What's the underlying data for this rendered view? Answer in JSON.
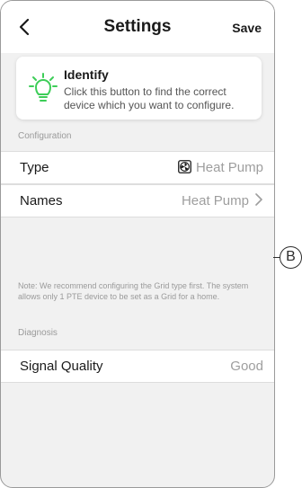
{
  "header": {
    "title": "Settings",
    "save_label": "Save"
  },
  "identify": {
    "title": "Identify",
    "description": "Click this button to find the correct device which you want to configure.",
    "icon": "lightbulb-icon",
    "accent_color": "#3dcd58"
  },
  "configuration": {
    "label": "Configuration",
    "type_label": "Type",
    "type_value": "Heat Pump",
    "type_icon": "fan-icon",
    "names_label": "Names",
    "names_value": "Heat Pump"
  },
  "note": "Note: We recommend configuring the Grid type first. The system allows only 1 PTE device to be set as a Grid for a home.",
  "diagnosis": {
    "label": "Diagnosis",
    "signal_label": "Signal Quality",
    "signal_value": "Good"
  },
  "callout": {
    "label": "B"
  }
}
